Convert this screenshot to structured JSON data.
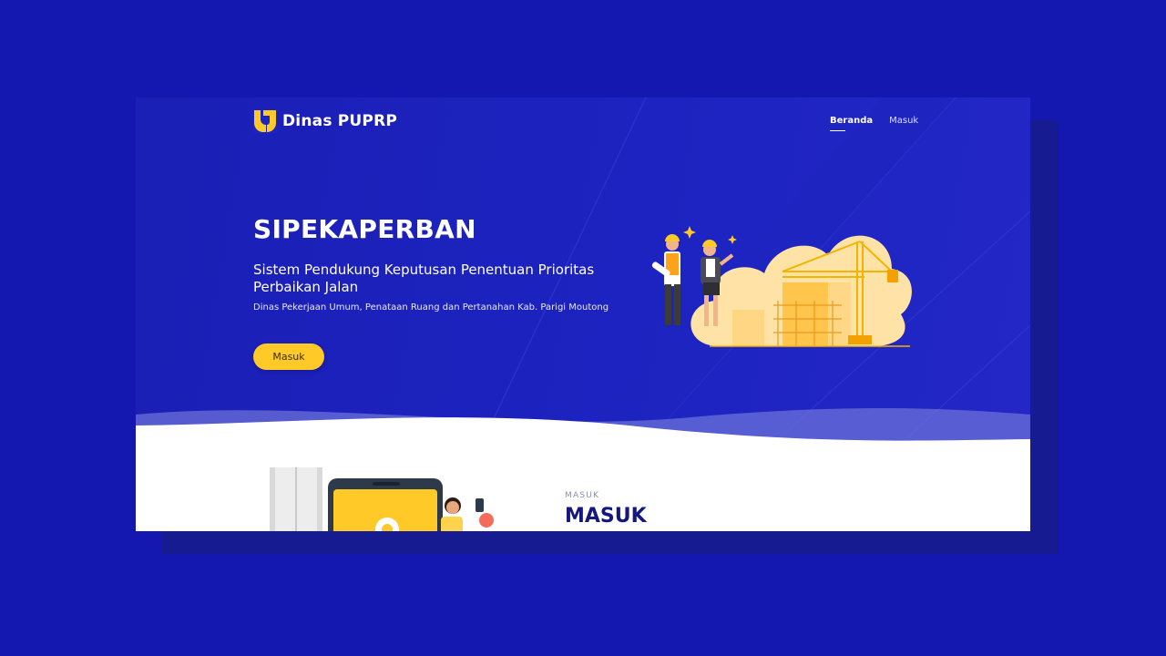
{
  "brand": {
    "name": "Dinas PUPRP",
    "logo_icon": "puprp-logo-icon"
  },
  "nav": {
    "items": [
      {
        "label": "Beranda",
        "active": true
      },
      {
        "label": "Masuk",
        "active": false
      }
    ]
  },
  "hero": {
    "title": "SIPEKAPERBAN",
    "subtitle": "Sistem Pendukung Keputusan Penentuan Prioritas Perbaikan Jalan",
    "description": "Dinas Pekerjaan Umum, Penataan Ruang dan Pertanahan Kab. Parigi Moutong",
    "cta_label": "Masuk",
    "illustration_icon": "construction-workers-illustration"
  },
  "section": {
    "kicker": "MASUK",
    "title": "MASUK",
    "illustration_icon": "phone-login-illustration"
  },
  "colors": {
    "background": "#1418b0",
    "hero": "#1d23c0",
    "accent": "#ffc928",
    "section_title": "#14177e"
  }
}
